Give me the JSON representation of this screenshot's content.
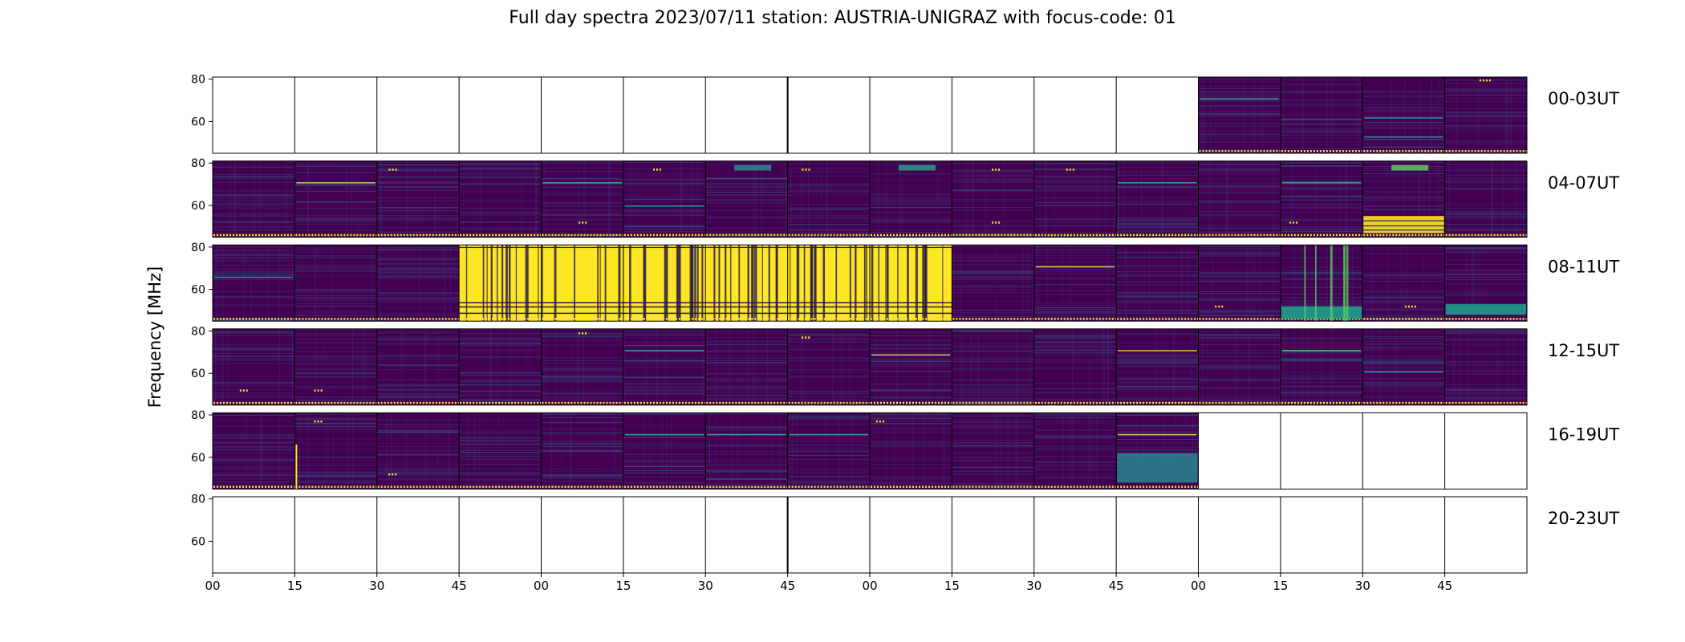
{
  "chart_data": {
    "type": "heatmap",
    "title": "Full day spectra 2023/07/11 station: AUSTRIA-UNIGRAZ with focus-code: 01",
    "ylabel": "Frequency [MHz]",
    "xlabel": "",
    "ylim": [
      45,
      81
    ],
    "y_ticks": [
      60,
      80
    ],
    "x_tick_labels": [
      "00",
      "15",
      "30",
      "45",
      "00",
      "15",
      "30",
      "45",
      "00",
      "15",
      "30",
      "45",
      "00",
      "15",
      "30",
      "45"
    ],
    "segment_minutes": 15,
    "segments_per_row": 16,
    "colormap": [
      "#440154",
      "#3b528b",
      "#21918c",
      "#5ec962",
      "#fde725"
    ],
    "rows": [
      {
        "label": "00-03UT",
        "hours": [
          0,
          1,
          2,
          3
        ],
        "data_segments": [
          12,
          13,
          14,
          15
        ],
        "features": [
          {
            "segment": 12,
            "kind": "line",
            "freq": 71,
            "color": "#3b9a8e"
          },
          {
            "segment": 14,
            "kind": "line",
            "freq": 62,
            "color": "#2e8c8a"
          },
          {
            "segment": 14,
            "kind": "line",
            "freq": 53,
            "color": "#2e8c8a"
          },
          {
            "segment": 15,
            "kind": "dots",
            "freq": 79.5,
            "color": "#fde725"
          }
        ]
      },
      {
        "label": "04-07UT",
        "hours": [
          4,
          5,
          6,
          7
        ],
        "data_segments": [
          0,
          1,
          2,
          3,
          4,
          5,
          6,
          7,
          8,
          9,
          10,
          11,
          12,
          13,
          14,
          15
        ],
        "features": [
          {
            "segment": 1,
            "kind": "line",
            "freq": 71,
            "color": "#c7c44a"
          },
          {
            "segment": 2,
            "kind": "dots",
            "freq": 77,
            "color": "#fde725"
          },
          {
            "segment": 4,
            "kind": "line",
            "freq": 71,
            "color": "#3b9a8e"
          },
          {
            "segment": 4,
            "kind": "dots",
            "freq": 52,
            "color": "#fde725"
          },
          {
            "segment": 5,
            "kind": "line",
            "freq": 60,
            "color": "#21918c"
          },
          {
            "segment": 5,
            "kind": "dots",
            "freq": 77,
            "color": "#fde725"
          },
          {
            "segment": 6,
            "kind": "patch",
            "freq": 78,
            "color": "#2f8a8c"
          },
          {
            "segment": 7,
            "kind": "dots",
            "freq": 77,
            "color": "#fde725"
          },
          {
            "segment": 8,
            "kind": "patch",
            "freq": 78,
            "color": "#2e9b8f"
          },
          {
            "segment": 9,
            "kind": "dots",
            "freq": 77,
            "color": "#fde725"
          },
          {
            "segment": 9,
            "kind": "dots",
            "freq": 52,
            "color": "#fde725"
          },
          {
            "segment": 10,
            "kind": "dots",
            "freq": 77,
            "color": "#fde725"
          },
          {
            "segment": 11,
            "kind": "line",
            "freq": 71,
            "color": "#3b9a8e"
          },
          {
            "segment": 13,
            "kind": "line",
            "freq": 71,
            "color": "#3b9a8e"
          },
          {
            "segment": 13,
            "kind": "dots",
            "freq": 52,
            "color": "#fde725"
          },
          {
            "segment": 14,
            "kind": "band",
            "freq_low": 47,
            "freq_high": 55,
            "color": "#fde725"
          },
          {
            "segment": 14,
            "kind": "patch",
            "freq": 78,
            "color": "#5ec962"
          }
        ]
      },
      {
        "label": "08-11UT",
        "hours": [
          8,
          9,
          10,
          11
        ],
        "data_segments": [
          0,
          1,
          2,
          3,
          4,
          5,
          6,
          7,
          8,
          9,
          10,
          11,
          12,
          13,
          14,
          15
        ],
        "saturated_segments": [
          3,
          4,
          5,
          6,
          7,
          8
        ],
        "features": [
          {
            "segment": 0,
            "kind": "line",
            "freq": 66,
            "color": "#21918c"
          },
          {
            "segment": 10,
            "kind": "line",
            "freq": 71,
            "color": "#c7c44a"
          },
          {
            "segment": 12,
            "kind": "dots",
            "freq": 52,
            "color": "#fde725"
          },
          {
            "segment": 13,
            "kind": "band",
            "freq_low": 46,
            "freq_high": 52,
            "color": "#21a08a"
          },
          {
            "segment": 13,
            "kind": "vlines",
            "color": "#5ec962"
          },
          {
            "segment": 14,
            "kind": "dots",
            "freq": 52,
            "color": "#fde725"
          },
          {
            "segment": 15,
            "kind": "band",
            "freq_low": 48,
            "freq_high": 53,
            "color": "#1f9a8a"
          }
        ]
      },
      {
        "label": "12-15UT",
        "hours": [
          12,
          13,
          14,
          15
        ],
        "data_segments": [
          0,
          1,
          2,
          3,
          4,
          5,
          6,
          7,
          8,
          9,
          10,
          11,
          12,
          13,
          14,
          15
        ],
        "features": [
          {
            "segment": 0,
            "kind": "dots",
            "freq": 52,
            "color": "#fde725"
          },
          {
            "segment": 1,
            "kind": "dots",
            "freq": 52,
            "color": "#fde725"
          },
          {
            "segment": 4,
            "kind": "dots",
            "freq": 79,
            "color": "#fde725"
          },
          {
            "segment": 5,
            "kind": "line",
            "freq": 71,
            "color": "#3b9a8e"
          },
          {
            "segment": 7,
            "kind": "dots",
            "freq": 77,
            "color": "#fde725"
          },
          {
            "segment": 8,
            "kind": "line",
            "freq": 69,
            "color": "#c7c44a"
          },
          {
            "segment": 11,
            "kind": "line",
            "freq": 71,
            "color": "#c7c44a"
          },
          {
            "segment": 13,
            "kind": "line",
            "freq": 71,
            "color": "#5ec962"
          },
          {
            "segment": 14,
            "kind": "line",
            "freq": 61,
            "color": "#3b9a8e"
          }
        ]
      },
      {
        "label": "16-19UT",
        "hours": [
          16,
          17,
          18,
          19
        ],
        "data_segments": [
          0,
          1,
          2,
          3,
          4,
          5,
          6,
          7,
          8,
          9,
          10,
          11
        ],
        "features": [
          {
            "segment": 1,
            "kind": "dots",
            "freq": 77,
            "color": "#fde725"
          },
          {
            "segment": 1,
            "kind": "vline",
            "color": "#fde725"
          },
          {
            "segment": 2,
            "kind": "dots",
            "freq": 52,
            "color": "#fde725"
          },
          {
            "segment": 5,
            "kind": "line",
            "freq": 71,
            "color": "#3b9a8e"
          },
          {
            "segment": 6,
            "kind": "line",
            "freq": 71,
            "color": "#3b9a8e"
          },
          {
            "segment": 7,
            "kind": "line",
            "freq": 71,
            "color": "#3b9a8e"
          },
          {
            "segment": 8,
            "kind": "dots",
            "freq": 77,
            "color": "#fde725"
          },
          {
            "segment": 11,
            "kind": "line",
            "freq": 71,
            "color": "#c7c44a"
          },
          {
            "segment": 11,
            "kind": "band",
            "freq_low": 48,
            "freq_high": 62,
            "color": "#2a7e8d"
          }
        ]
      },
      {
        "label": "20-23UT",
        "hours": [
          20,
          21,
          22,
          23
        ],
        "data_segments": [],
        "features": []
      }
    ]
  }
}
